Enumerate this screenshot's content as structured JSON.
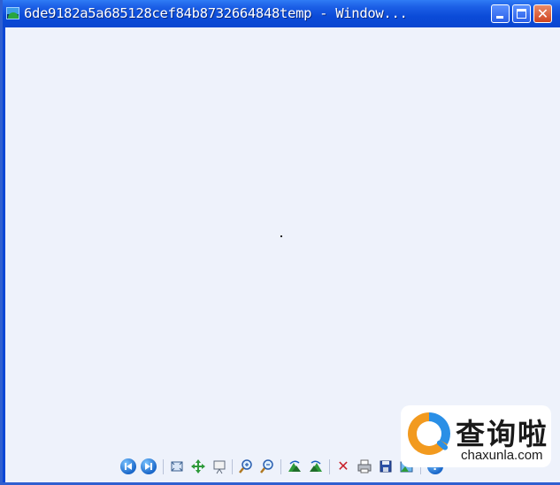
{
  "window": {
    "title": "6de9182a5a685128cef84b8732664848temp - Window...",
    "buttons": {
      "minimize": "minimize",
      "maximize": "maximize",
      "close": "✕"
    }
  },
  "toolbar": {
    "items": [
      {
        "name": "previous-image",
        "icon": "previous-icon"
      },
      {
        "name": "next-image",
        "icon": "next-icon"
      },
      {
        "name": "best-fit",
        "icon": "best-fit-icon"
      },
      {
        "name": "actual-size",
        "icon": "actual-size-icon"
      },
      {
        "name": "slide-show",
        "icon": "slideshow-icon"
      },
      {
        "name": "zoom-in",
        "icon": "zoom-in-icon"
      },
      {
        "name": "zoom-out",
        "icon": "zoom-out-icon"
      },
      {
        "name": "rotate-clockwise",
        "icon": "rotate-clockwise-icon"
      },
      {
        "name": "rotate-counterclockwise",
        "icon": "rotate-counterclockwise-icon"
      },
      {
        "name": "delete",
        "icon": "delete-icon"
      },
      {
        "name": "print",
        "icon": "print-icon"
      },
      {
        "name": "save-copy",
        "icon": "save-icon"
      },
      {
        "name": "open-for-editing",
        "icon": "edit-icon"
      },
      {
        "name": "help",
        "icon": "help-icon"
      }
    ],
    "delete_glyph": "✕"
  },
  "watermark": {
    "chinese_text": "查询啦",
    "site": "chaxunla.com"
  },
  "colors": {
    "titlebar": "#0b4bd8",
    "client_background": "#eef2fb",
    "delete_red": "#c8202a"
  }
}
